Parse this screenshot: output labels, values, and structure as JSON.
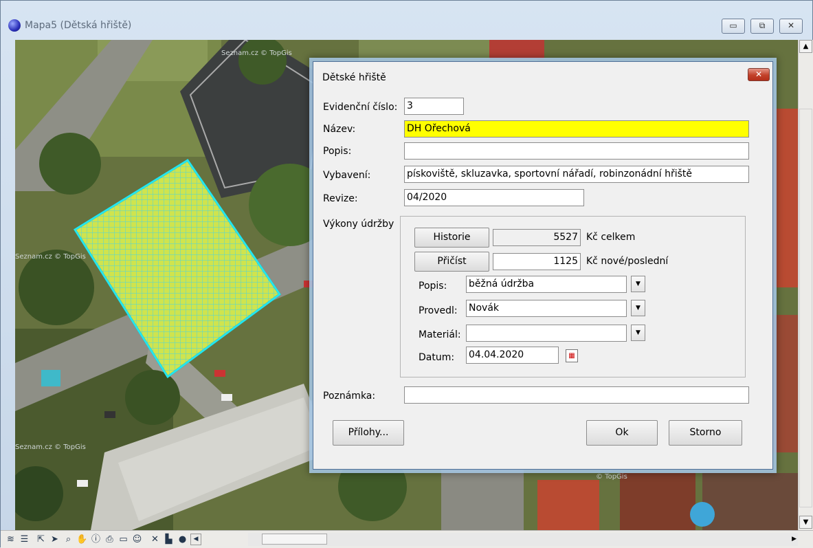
{
  "window": {
    "title": "Mapa5 (Dětská hřiště)",
    "buttons": [
      "▭",
      "⧉",
      "✕"
    ]
  },
  "map": {
    "watermarks": [
      "Seznam.cz © TopGis",
      "Seznam.cz © TopGis",
      "Seznam.cz © TopGis",
      "© TopGis"
    ],
    "polygon_color": "#24e6ee",
    "polygon_fill": "#cfe44e"
  },
  "toolbar": {
    "icons": [
      "layers-icon",
      "legend-icon",
      "select-icon",
      "pointer-icon",
      "zoom-icon",
      "pan-icon",
      "info-icon",
      "print-icon",
      "rectangle-icon",
      "person-icon",
      "close-icon",
      "chart-icon",
      "pin-icon"
    ]
  },
  "dialog": {
    "title": "Dětské hřiště",
    "close": "✕",
    "fields": {
      "evidencni_cislo": {
        "label": "Evidenční číslo:",
        "value": "3"
      },
      "nazev": {
        "label": "Název:",
        "value": "DH Ořechová",
        "highlight": "#ffff00"
      },
      "popis": {
        "label": "Popis:",
        "value": ""
      },
      "vybaveni": {
        "label": "Vybavení:",
        "value": "pískoviště, skluzavka, sportovní nářadí, robinzonádní hřiště"
      },
      "revize": {
        "label": "Revize:",
        "value": "04/2020"
      }
    },
    "maintenance": {
      "label": "Výkony údržby",
      "historie_button": "Historie",
      "total_value": "5527",
      "total_unit": "Kč celkem",
      "pricist_button": "Přičíst",
      "last_value": "1125",
      "last_unit": "Kč nové/poslední",
      "popis": {
        "label": "Popis:",
        "value": "běžná údržba"
      },
      "provedl": {
        "label": "Provedl:",
        "value": "Novák"
      },
      "material": {
        "label": "Materiál:",
        "value": ""
      },
      "datum": {
        "label": "Datum:",
        "value": "04.04.2020"
      }
    },
    "poznamka": {
      "label": "Poznámka:",
      "value": ""
    },
    "buttons": {
      "prilohy": "Přílohy...",
      "ok": "Ok",
      "storno": "Storno"
    }
  }
}
